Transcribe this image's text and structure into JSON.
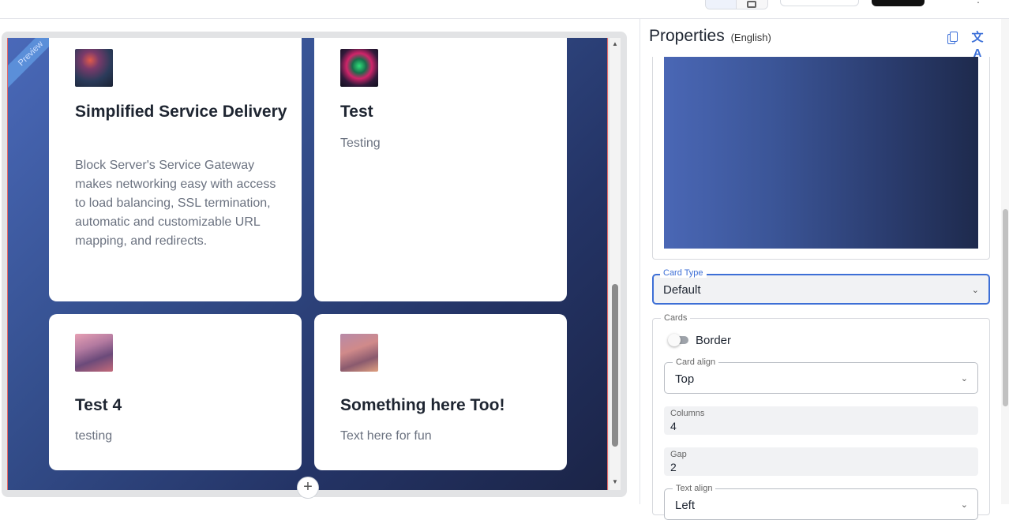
{
  "preview": {
    "ribbon": "Preview",
    "add_button": "+",
    "cards": [
      {
        "title": "Simplified Service Delivery",
        "text": "Block Server's Service Gateway makes networking easy with access to load balancing, SSL termination, automatic and customizable URL mapping, and redirects.",
        "thumb_icon": "space-image"
      },
      {
        "title": "Test",
        "text": "Testing",
        "thumb_icon": "neon-triangle-image"
      },
      {
        "title": "Test 4",
        "text": "testing",
        "thumb_icon": "fantasy-figure-image"
      },
      {
        "title": "Something here Too!",
        "text": "Text here for fun",
        "thumb_icon": "desert-rider-image"
      }
    ]
  },
  "properties": {
    "title": "Properties",
    "language": "(English)",
    "background_gradient": {
      "from": "#4a67b5",
      "to": "#1e2a4d"
    },
    "card_type": {
      "label": "Card Type",
      "value": "Default"
    },
    "cards_group": {
      "label": "Cards",
      "border_label": "Border",
      "border_enabled": false,
      "card_align": {
        "label": "Card align",
        "value": "Top"
      },
      "columns": {
        "label": "Columns",
        "value": "4"
      },
      "gap": {
        "label": "Gap",
        "value": "2"
      },
      "text_align": {
        "label": "Text align",
        "value": "Left"
      }
    }
  },
  "colors": {
    "accent": "#3d6fd6",
    "canvas_from": "#4a69b9",
    "canvas_to": "#1b2447"
  }
}
